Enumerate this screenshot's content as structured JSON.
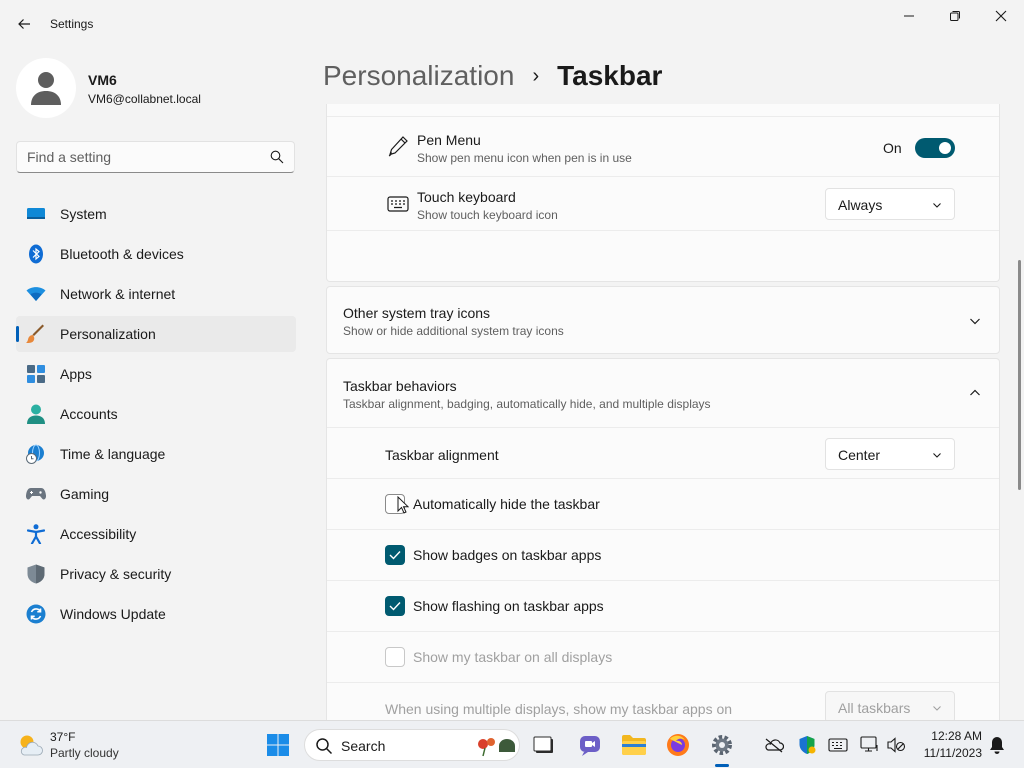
{
  "window": {
    "title": "Settings"
  },
  "profile": {
    "name": "VM6",
    "email": "VM6@collabnet.local"
  },
  "search": {
    "placeholder": "Find a setting"
  },
  "nav": {
    "items": [
      {
        "label": "System"
      },
      {
        "label": "Bluetooth & devices"
      },
      {
        "label": "Network & internet"
      },
      {
        "label": "Personalization"
      },
      {
        "label": "Apps"
      },
      {
        "label": "Accounts"
      },
      {
        "label": "Time & language"
      },
      {
        "label": "Gaming"
      },
      {
        "label": "Accessibility"
      },
      {
        "label": "Privacy & security"
      },
      {
        "label": "Windows Update"
      }
    ],
    "active_index": 3
  },
  "breadcrumb": {
    "parent": "Personalization",
    "separator": "›",
    "current": "Taskbar"
  },
  "corner_icons": {
    "pen_menu": {
      "title": "Pen Menu",
      "subtitle": "Show pen menu icon when pen is in use",
      "state_label": "On",
      "on": true
    },
    "touch_keyboard": {
      "title": "Touch keyboard",
      "subtitle": "Show touch keyboard icon",
      "value": "Always"
    }
  },
  "other_tray": {
    "title": "Other system tray icons",
    "subtitle": "Show or hide additional system tray icons",
    "expanded": false
  },
  "behaviors": {
    "title": "Taskbar behaviors",
    "subtitle": "Taskbar alignment, badging, automatically hide, and multiple displays",
    "expanded": true,
    "alignment": {
      "label": "Taskbar alignment",
      "value": "Center"
    },
    "auto_hide": {
      "label": "Automatically hide the taskbar",
      "checked": false
    },
    "badges": {
      "label": "Show badges on taskbar apps",
      "checked": true
    },
    "flashing": {
      "label": "Show flashing on taskbar apps",
      "checked": true
    },
    "all_displays": {
      "label": "Show my taskbar on all displays",
      "checked": false,
      "disabled": true
    },
    "multi_display": {
      "label": "When using multiple displays, show my taskbar apps on",
      "value": "All taskbars",
      "disabled": true
    }
  },
  "taskbar": {
    "weather": {
      "temp": "37°F",
      "desc": "Partly cloudy"
    },
    "search_label": "Search",
    "clock": {
      "time": "12:28 AM",
      "date": "11/11/2023"
    }
  },
  "colors": {
    "accent": "#005a70",
    "nav_accent": "#005fb8"
  }
}
